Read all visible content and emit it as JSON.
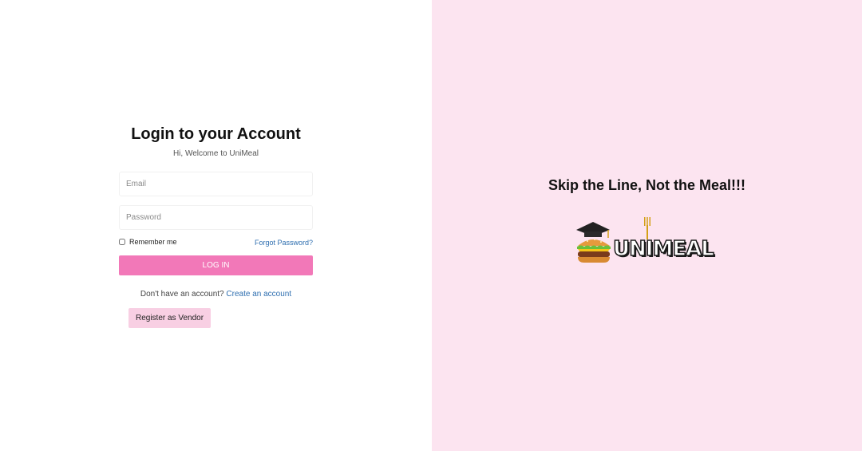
{
  "login": {
    "title": "Login to your Account",
    "subtitle": "Hi, Welcome to UniMeal",
    "email_placeholder": "Email",
    "password_placeholder": "Password",
    "remember_label": "Remember me",
    "forgot_label": "Forgot Password?",
    "login_button": "LOG IN",
    "no_account_text": "Don't have an account?",
    "create_account_link": "Create an account",
    "vendor_button": "Register as Vendor"
  },
  "promo": {
    "tagline": "Skip the Line, Not the Meal!!!",
    "logo_text": "UNIMEAL",
    "logo_icon": "burger-graduation-cap-icon"
  },
  "colors": {
    "accent": "#f278b8",
    "panel_bg": "#fce4f0",
    "vendor_button_bg": "#f8cfe3",
    "link": "#2f6fb0"
  }
}
